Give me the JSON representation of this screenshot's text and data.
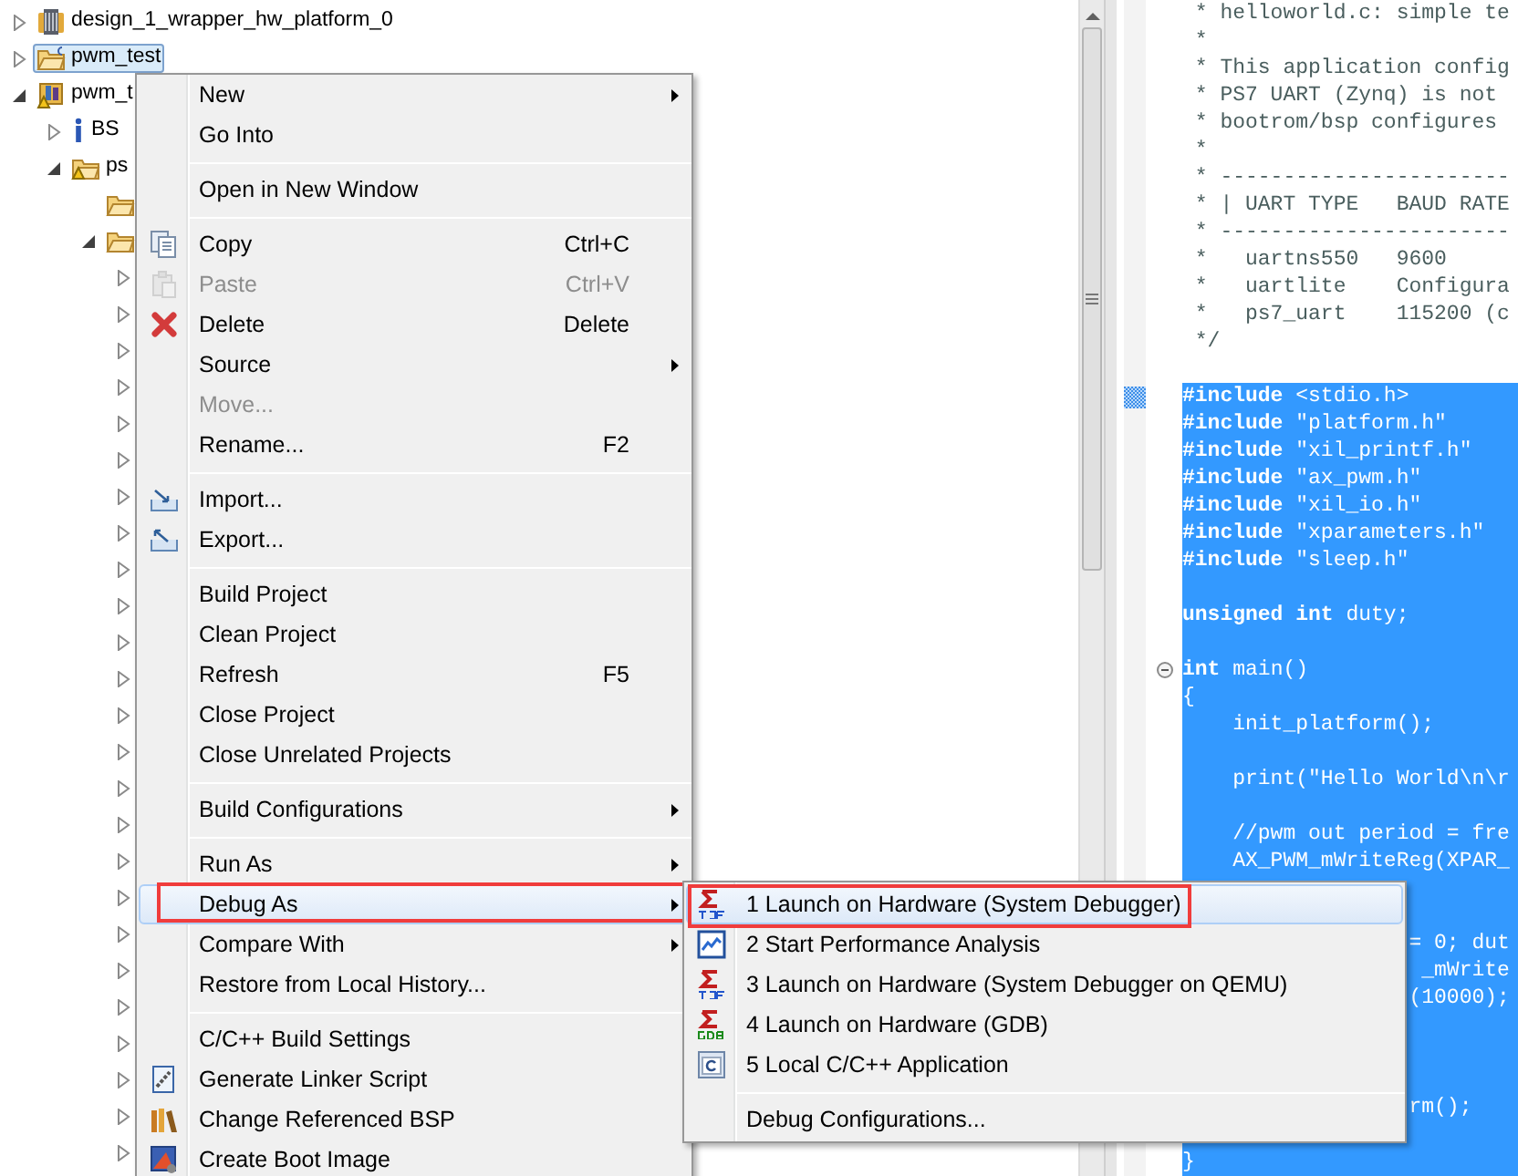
{
  "project_tree": {
    "items": [
      {
        "label": "design_1_wrapper_hw_platform_0",
        "kind": "hardware",
        "expanded": false,
        "selected": false
      },
      {
        "label": "pwm_test",
        "kind": "application",
        "expanded": false,
        "selected": true
      },
      {
        "label": "pwm_t",
        "kind": "bsp",
        "expanded": true,
        "selected": false,
        "children": [
          {
            "label": "BS",
            "kind": "info",
            "expanded": false,
            "selected": false
          },
          {
            "label": "ps",
            "kind": "warning-folder",
            "expanded": true,
            "selected": false,
            "children": [
              {
                "kind": "folder",
                "selected": false
              },
              {
                "kind": "folder",
                "expanded": true,
                "selected": false,
                "children": [
                  {
                    "expanded": false
                  },
                  {
                    "expanded": false
                  },
                  {
                    "expanded": false
                  },
                  {
                    "expanded": false
                  },
                  {
                    "expanded": false
                  },
                  {
                    "expanded": false
                  },
                  {
                    "expanded": false
                  },
                  {
                    "expanded": false
                  },
                  {
                    "expanded": false
                  },
                  {
                    "expanded": false
                  },
                  {
                    "expanded": false
                  },
                  {
                    "expanded": false
                  },
                  {
                    "expanded": false
                  },
                  {
                    "expanded": false
                  },
                  {
                    "expanded": false
                  },
                  {
                    "expanded": false
                  },
                  {
                    "expanded": false
                  },
                  {
                    "expanded": false
                  },
                  {
                    "expanded": false
                  },
                  {
                    "expanded": false
                  },
                  {
                    "expanded": false
                  },
                  {
                    "expanded": false
                  },
                  {
                    "expanded": false
                  },
                  {
                    "expanded": false
                  },
                  {
                    "expanded": false
                  }
                ]
              }
            ]
          }
        ]
      }
    ]
  },
  "editor": {
    "lines": [
      {
        "text": " * helloworld.c: simple te",
        "kind": "comment",
        "selected": false,
        "marker": false,
        "fold": false
      },
      {
        "text": " *",
        "kind": "comment",
        "selected": false,
        "marker": false,
        "fold": false
      },
      {
        "text": " * This application config",
        "kind": "comment",
        "selected": false,
        "marker": false,
        "fold": false
      },
      {
        "text": " * PS7 UART (Zynq) is not",
        "kind": "comment",
        "selected": false,
        "marker": false,
        "fold": false
      },
      {
        "text": " * bootrom/bsp configures",
        "kind": "comment",
        "selected": false,
        "marker": false,
        "fold": false
      },
      {
        "text": " *",
        "kind": "comment",
        "selected": false,
        "marker": false,
        "fold": false
      },
      {
        "text": " * -----------------------",
        "kind": "comment",
        "selected": false,
        "marker": false,
        "fold": false
      },
      {
        "text": " * | UART TYPE   BAUD RATE",
        "kind": "comment",
        "selected": false,
        "marker": false,
        "fold": false
      },
      {
        "text": " * -----------------------",
        "kind": "comment",
        "selected": false,
        "marker": false,
        "fold": false
      },
      {
        "text": " *   uartns550   9600",
        "kind": "comment",
        "selected": false,
        "marker": false,
        "fold": false
      },
      {
        "text": " *   uartlite    Configura",
        "kind": "comment",
        "selected": false,
        "marker": false,
        "fold": false
      },
      {
        "text": " *   ps7_uart    115200 (c",
        "kind": "comment",
        "selected": false,
        "marker": false,
        "fold": false
      },
      {
        "text": " */",
        "kind": "comment",
        "selected": false,
        "marker": false,
        "fold": false
      },
      {
        "kind": "blank"
      },
      {
        "text": "**#include** <stdio.h>",
        "kind": "code",
        "selected": true,
        "marker": true,
        "fold": false
      },
      {
        "text": "**#include** \"platform.h\"",
        "kind": "code",
        "selected": true,
        "marker": false,
        "fold": false
      },
      {
        "text": "**#include** \"xil_printf.h\"",
        "kind": "code",
        "selected": true,
        "marker": false,
        "fold": false
      },
      {
        "text": "**#include** \"ax_pwm.h\"",
        "kind": "code",
        "selected": true,
        "marker": false,
        "fold": false
      },
      {
        "text": "**#include** \"xil_io.h\"",
        "kind": "code",
        "selected": true,
        "marker": false,
        "fold": false
      },
      {
        "text": "**#include** \"xparameters.h\"",
        "kind": "code",
        "selected": true,
        "marker": false,
        "fold": false
      },
      {
        "text": "**#include** \"sleep.h\"",
        "kind": "code",
        "selected": true,
        "marker": false,
        "fold": false
      },
      {
        "kind": "code",
        "selected": true,
        "marker": false,
        "fold": false
      },
      {
        "text": "**unsigned int** duty;",
        "kind": "code",
        "selected": true,
        "marker": false,
        "fold": false
      },
      {
        "kind": "code",
        "selected": true,
        "marker": false,
        "fold": false
      },
      {
        "text": "**int** main()",
        "kind": "code",
        "selected": true,
        "marker": false,
        "fold": true
      },
      {
        "text": "{",
        "kind": "code",
        "selected": true,
        "marker": false,
        "fold": false
      },
      {
        "text": "    init_platform();",
        "kind": "code",
        "selected": true,
        "marker": false,
        "fold": false
      },
      {
        "kind": "code",
        "selected": true,
        "marker": false,
        "fold": false
      },
      {
        "text": "    print(\"Hello World\\n\\r",
        "kind": "code",
        "selected": true,
        "marker": false,
        "fold": false
      },
      {
        "kind": "code",
        "selected": true,
        "marker": false,
        "fold": false
      },
      {
        "text": "    //pwm out period = fre",
        "kind": "code",
        "selected": true,
        "marker": false,
        "fold": false
      },
      {
        "text": "    AX_PWM_mWriteReg(XPAR_",
        "kind": "code",
        "selected": true,
        "marker": false,
        "fold": false
      },
      {
        "kind": "code",
        "selected": true,
        "marker": false,
        "fold": false
      },
      {
        "kind": "code",
        "selected": true,
        "marker": false,
        "fold": false
      },
      {
        "text": "                  = 0; dut",
        "kind": "code",
        "selected": true,
        "marker": false,
        "fold": false
      },
      {
        "text": "                   _mWrite",
        "kind": "code",
        "selected": true,
        "marker": false,
        "fold": false
      },
      {
        "text": "                  (10000);",
        "kind": "code",
        "selected": true,
        "marker": false,
        "fold": false
      },
      {
        "kind": "code",
        "selected": true,
        "marker": false,
        "fold": false
      },
      {
        "kind": "code",
        "selected": true,
        "marker": false,
        "fold": false
      },
      {
        "kind": "code",
        "selected": true,
        "marker": false,
        "fold": false
      },
      {
        "text": "                  rm();",
        "kind": "code",
        "selected": true,
        "marker": false,
        "fold": false
      },
      {
        "kind": "code",
        "selected": true,
        "marker": false,
        "fold": false
      },
      {
        "text": "}",
        "kind": "code",
        "selected": true,
        "marker": false,
        "fold": false
      }
    ]
  },
  "context_menu": {
    "items": [
      {
        "kind": "plain",
        "label": "New",
        "submenu": true,
        "disabled": false,
        "selected": false,
        "marked": false
      },
      {
        "kind": "plain",
        "label": "Go Into",
        "submenu": false,
        "disabled": false,
        "selected": false,
        "marked": false
      },
      {
        "kind": "separator"
      },
      {
        "kind": "plain",
        "label": "Open in New Window",
        "submenu": false,
        "disabled": false,
        "selected": false,
        "marked": false
      },
      {
        "kind": "separator"
      },
      {
        "kind": "copy",
        "label": "Copy",
        "shortcut": "Ctrl+C",
        "submenu": false,
        "disabled": false,
        "selected": false,
        "marked": false
      },
      {
        "kind": "paste",
        "label": "Paste",
        "shortcut": "Ctrl+V",
        "submenu": false,
        "disabled": true,
        "selected": false,
        "marked": false
      },
      {
        "kind": "delete",
        "label": "Delete",
        "shortcut": "Delete",
        "submenu": false,
        "disabled": false,
        "selected": false,
        "marked": false
      },
      {
        "kind": "plain",
        "label": "Source",
        "submenu": true,
        "disabled": false,
        "selected": false,
        "marked": false
      },
      {
        "kind": "plain",
        "label": "Move...",
        "submenu": false,
        "disabled": true,
        "selected": false,
        "marked": false
      },
      {
        "kind": "plain",
        "label": "Rename...",
        "shortcut": "F2",
        "submenu": false,
        "disabled": false,
        "selected": false,
        "marked": false
      },
      {
        "kind": "separator"
      },
      {
        "kind": "import",
        "label": "Import...",
        "submenu": false,
        "disabled": false,
        "selected": false,
        "marked": false
      },
      {
        "kind": "export",
        "label": "Export...",
        "submenu": false,
        "disabled": false,
        "selected": false,
        "marked": false
      },
      {
        "kind": "separator"
      },
      {
        "kind": "plain",
        "label": "Build Project",
        "submenu": false,
        "disabled": false,
        "selected": false,
        "marked": false
      },
      {
        "kind": "plain",
        "label": "Clean Project",
        "submenu": false,
        "disabled": false,
        "selected": false,
        "marked": false
      },
      {
        "kind": "plain",
        "label": "Refresh",
        "shortcut": "F5",
        "submenu": false,
        "disabled": false,
        "selected": false,
        "marked": false
      },
      {
        "kind": "plain",
        "label": "Close Project",
        "submenu": false,
        "disabled": false,
        "selected": false,
        "marked": false
      },
      {
        "kind": "plain",
        "label": "Close Unrelated Projects",
        "submenu": false,
        "disabled": false,
        "selected": false,
        "marked": false
      },
      {
        "kind": "separator"
      },
      {
        "kind": "plain",
        "label": "Build Configurations",
        "submenu": true,
        "disabled": false,
        "selected": false,
        "marked": false
      },
      {
        "kind": "separator"
      },
      {
        "kind": "plain",
        "label": "Run As",
        "submenu": true,
        "disabled": false,
        "selected": false,
        "marked": false
      },
      {
        "kind": "plain",
        "label": "Debug As",
        "submenu": true,
        "disabled": false,
        "selected": true,
        "marked": true,
        "items": [
          {
            "kind": "tcf",
            "label": "1 Launch on Hardware (System Debugger)",
            "selected": true,
            "marked": true
          },
          {
            "kind": "chart",
            "label": "2 Start Performance Analysis",
            "selected": false,
            "marked": false
          },
          {
            "kind": "tcf",
            "label": "3 Launch on Hardware (System Debugger on QEMU)",
            "selected": false,
            "marked": false
          },
          {
            "kind": "gdb",
            "label": "4 Launch on Hardware (GDB)",
            "selected": false,
            "marked": false
          },
          {
            "kind": "c-app",
            "label": "5 Local C/C++ Application",
            "selected": false,
            "marked": false
          },
          {
            "kind": "separator"
          },
          {
            "kind": "plain",
            "label": "Debug Configurations...",
            "selected": false,
            "marked": false
          }
        ]
      },
      {
        "kind": "plain",
        "label": "Compare With",
        "submenu": true,
        "disabled": false,
        "selected": false,
        "marked": false
      },
      {
        "kind": "plain",
        "label": "Restore from Local History...",
        "submenu": false,
        "disabled": false,
        "selected": false,
        "marked": false
      },
      {
        "kind": "separator"
      },
      {
        "kind": "plain",
        "label": "C/C++ Build Settings",
        "submenu": false,
        "disabled": false,
        "selected": false,
        "marked": false
      },
      {
        "kind": "linker",
        "label": "Generate Linker Script",
        "submenu": false,
        "disabled": false,
        "selected": false,
        "marked": false
      },
      {
        "kind": "bsp",
        "label": "Change Referenced BSP",
        "submenu": false,
        "disabled": false,
        "selected": false,
        "marked": false
      },
      {
        "kind": "boot",
        "label": "Create Boot Image",
        "submenu": false,
        "disabled": false,
        "selected": false,
        "marked": false
      }
    ]
  }
}
